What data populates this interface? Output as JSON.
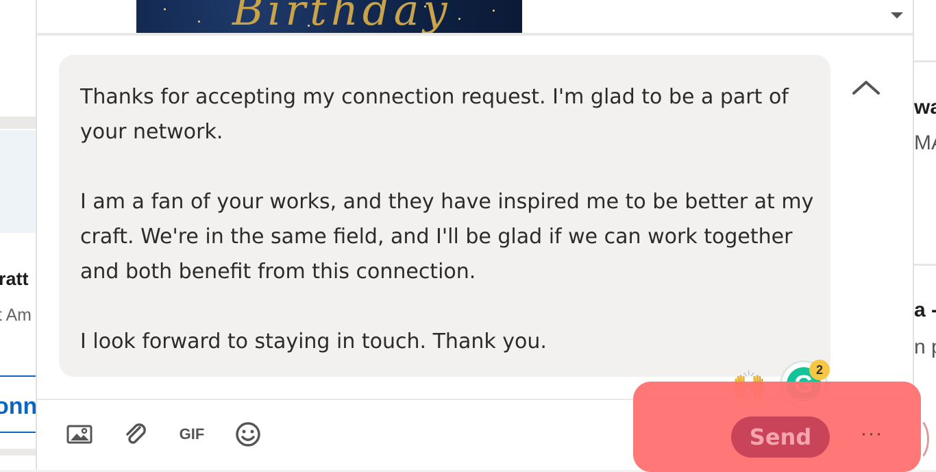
{
  "background": {
    "left": {
      "name_fragment": "ratt",
      "sub_fragment": "t Am",
      "button_fragment": "onn"
    },
    "right": {
      "line1": "wa",
      "line2": "MA",
      "line3": "a -",
      "line4": "n p"
    }
  },
  "modal": {
    "preview_banner_text": "Birthday",
    "message": {
      "paragraph1": "Thanks for accepting my connection request. I'm glad to be a part of your network.",
      "paragraph2": "I am a fan of your works, and they have inspired me to be better at my craft. We're in the same field, and I'll be glad if we can work together and both benefit from this connection.",
      "paragraph3": "I look forward to staying in touch. Thank you."
    },
    "emoji": "🙌",
    "grammarly": {
      "letter": "G",
      "badge_count": "2"
    },
    "toolbar": {
      "gif_label": "GIF",
      "send_label": "Send",
      "more_label": "···"
    },
    "icons": [
      "image-icon",
      "paperclip-icon",
      "gif-icon",
      "emoji-icon",
      "chevron-up-icon",
      "dropdown-arrow-icon"
    ]
  },
  "colors": {
    "highlight": "#ff7070",
    "send_button": "#c94359",
    "bubble": "#f3f1ef",
    "grammarly": "#15c39a"
  }
}
